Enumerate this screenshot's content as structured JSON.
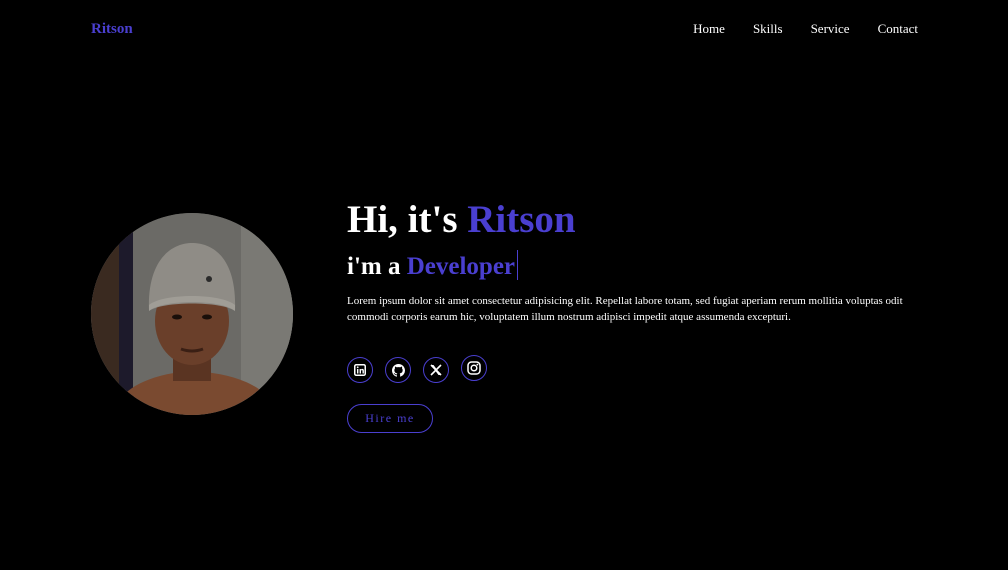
{
  "header": {
    "logo": "Ritson",
    "nav": [
      {
        "label": "Home"
      },
      {
        "label": "Skills"
      },
      {
        "label": "Service"
      },
      {
        "label": "Contact"
      }
    ]
  },
  "hero": {
    "greeting": "Hi, it's ",
    "name": "Ritson",
    "role_prefix": "i'm a ",
    "role": "Developer",
    "description": "Lorem ipsum dolor sit amet consectetur adipisicing elit. Repellat labore totam, sed fugiat aperiam rerum mollitia voluptas odit commodi corporis earum hic, voluptatem illum nostrum adipisci impedit atque assumenda excepturi."
  },
  "socials": [
    {
      "icon": "linkedin-icon"
    },
    {
      "icon": "github-icon"
    },
    {
      "icon": "x-twitter-icon"
    },
    {
      "icon": "instagram-icon"
    }
  ],
  "cta": {
    "hire_label": "Hire me"
  },
  "colors": {
    "background": "#000000",
    "accent": "#4a3fd0",
    "text": "#ffffff"
  }
}
